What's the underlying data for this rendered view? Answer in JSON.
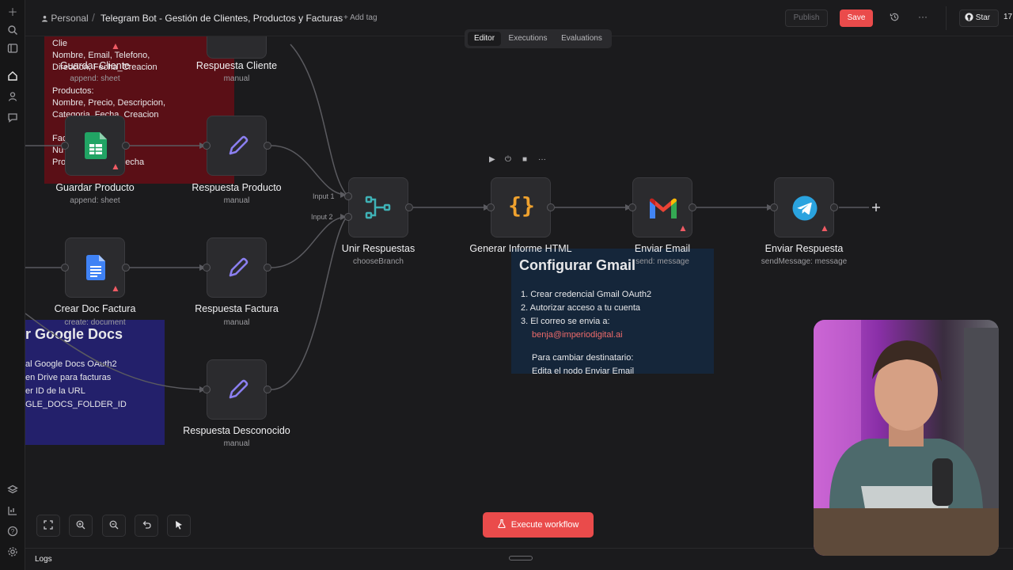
{
  "topbar": {
    "workspace": "Personal",
    "separator": "/",
    "workflow_title": "Telegram Bot - Gestión de Clientes, Productos y Facturas",
    "add_tag": "+ Add tag",
    "publish_label": "Publish",
    "save_label": "Save",
    "star_label": "Star",
    "star_count": "17"
  },
  "tabs": [
    {
      "label": "Editor",
      "active": true
    },
    {
      "label": "Executions",
      "active": false
    },
    {
      "label": "Evaluations",
      "active": false
    }
  ],
  "stickies": {
    "sheets_note": {
      "lines": [
        "Clie",
        "Nombre, Email, Telefono,",
        "Direccion, Fecha_Creacion",
        "",
        "Productos:",
        "Nombre, Precio, Descripcion,",
        "Categoria, Fecha_Creacion",
        "",
        "Fac",
        "Nu            Cliente,",
        "Pro           Notas, Fecha"
      ],
      "color": "#5a0f16"
    },
    "docs_note": {
      "title": "r Google Docs",
      "lines": [
        "al Google Docs OAuth2",
        "en Drive para facturas",
        "er ID de la URL",
        "GLE_DOCS_FOLDER_ID"
      ],
      "color": "#23206b"
    },
    "gmail_note": {
      "title": "Configurar Gmail",
      "items": [
        "Crear credencial Gmail OAuth2",
        "Autorizar acceso a tu cuenta",
        "El correo se envia a:"
      ],
      "email": "benja@imperiodigital.ai",
      "footer": "Para cambiar destinatario:",
      "footer2": "Edita el nodo Enviar Email",
      "color": "#15263a"
    }
  },
  "nodes": {
    "guardar_cliente": {
      "title": "Guardar Cliente",
      "subtitle": "append: sheet"
    },
    "respuesta_cliente": {
      "title": "Respuesta Cliente",
      "subtitle": "manual"
    },
    "guardar_producto": {
      "title": "Guardar Producto",
      "subtitle": "append: sheet"
    },
    "respuesta_producto": {
      "title": "Respuesta Producto",
      "subtitle": "manual"
    },
    "crear_doc_factura": {
      "title": "Crear Doc Factura",
      "subtitle": "create: document"
    },
    "respuesta_factura": {
      "title": "Respuesta Factura",
      "subtitle": "manual"
    },
    "respuesta_desconocido": {
      "title": "Respuesta Desconocido",
      "subtitle": "manual"
    },
    "unir_respuestas": {
      "title": "Unir Respuestas",
      "subtitle": "chooseBranch",
      "input1": "Input 1",
      "input2": "Input 2"
    },
    "generar_informe": {
      "title": "Generar Informe HTML"
    },
    "enviar_email": {
      "title": "Enviar Email",
      "subtitle": "send: message"
    },
    "enviar_respuesta": {
      "title": "Enviar Respuesta",
      "subtitle": "sendMessage: message"
    }
  },
  "icons": {
    "rail": [
      "plus-icon",
      "search-icon",
      "panel-icon",
      "home-icon",
      "user-icon",
      "chat-icon",
      "templates-icon",
      "insights-icon",
      "help-icon",
      "settings-icon"
    ],
    "node_toolbar": [
      "play-icon",
      "power-icon",
      "trash-icon",
      "more-icon"
    ],
    "controls": [
      "fit-view-icon",
      "zoom-in-icon",
      "zoom-out-icon",
      "undo-icon",
      "pointer-icon"
    ]
  },
  "execute_label": "Execute workflow",
  "logs_label": "Logs",
  "colors": {
    "accent": "#ea4b4b",
    "warning": "#ef5b64",
    "canvas": "#1b1b1d"
  }
}
